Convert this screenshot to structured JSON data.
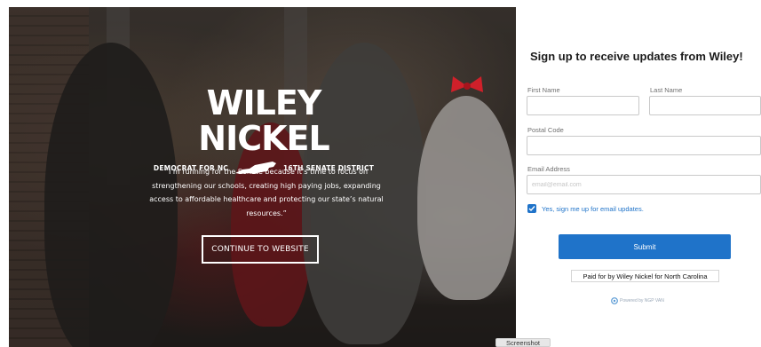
{
  "hero": {
    "logo_name": "WILEY NICKEL",
    "logo_left": "DEMOCRAT FOR NC",
    "logo_right": "16TH SENATE DISTRICT",
    "quote": "“I’m running for the Senate because it’s time to focus on strengthening our schools, creating high paying jobs, expanding access to affordable healthcare and protecting our state’s natural resources.”",
    "continue_label": "CONTINUE TO WEBSITE"
  },
  "form": {
    "title": "Sign up to receive updates from Wiley!",
    "first_name_label": "First Name",
    "first_name_value": "",
    "last_name_label": "Last Name",
    "last_name_value": "",
    "postal_label": "Postal Code",
    "postal_value": "",
    "email_label": "Email Address",
    "email_placeholder": "email@email.com",
    "email_value": "",
    "optin_label": "Yes, sign me up for email updates.",
    "optin_checked": true,
    "submit_label": "Submit",
    "paid_for": "Paid for by Wiley Nickel for North Carolina",
    "powered_by": "Powered by NGP VAN"
  },
  "tooltip": "Screenshot",
  "colors": {
    "accent": "#1f73c9",
    "hero_text": "#ffffff"
  },
  "icons": {
    "checkbox": "checkmark-icon",
    "state_map": "north-carolina-map-icon",
    "powered": "ngp-van-logo-icon"
  }
}
